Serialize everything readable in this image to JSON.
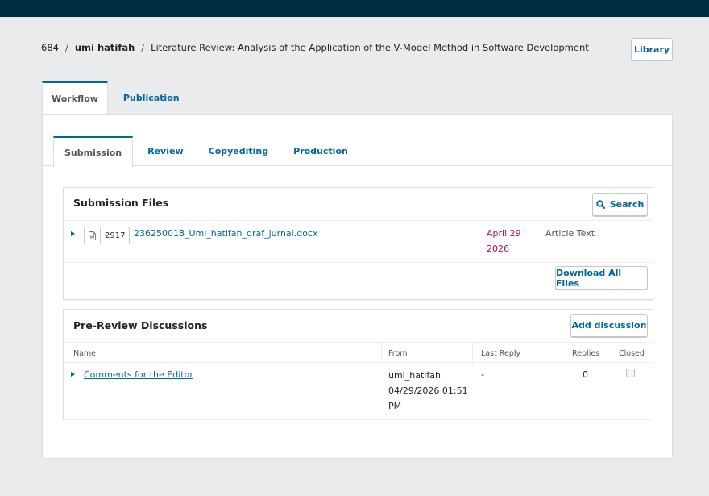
{
  "breadcrumb": {
    "id": "684",
    "separator": "/",
    "author": "umi hatifah",
    "title": "Literature Review: Analysis of the Application of the V-Model Method in Software Development"
  },
  "library_button": "Library",
  "main_tabs": [
    {
      "label": "Workflow",
      "active": true
    },
    {
      "label": "Publication",
      "active": false
    }
  ],
  "stage_tabs": [
    {
      "label": "Submission",
      "active": true
    },
    {
      "label": "Review",
      "active": false
    },
    {
      "label": "Copyediting",
      "active": false
    },
    {
      "label": "Production",
      "active": false
    }
  ],
  "submission_files": {
    "title": "Submission Files",
    "search_label": "Search",
    "files": [
      {
        "id": "2917",
        "name": "236250018_Umi_hatifah_draf_jurnal.docx",
        "date_line1": "April 29",
        "date_line2": "2026",
        "type": "Article Text"
      }
    ],
    "download_all_label": "Download All Files"
  },
  "discussions": {
    "title": "Pre-Review Discussions",
    "add_label": "Add discussion",
    "columns": {
      "name": "Name",
      "from": "From",
      "last_reply": "Last Reply",
      "replies": "Replies",
      "closed": "Closed"
    },
    "rows": [
      {
        "name": "Comments for the Editor",
        "from_user": "umi_hatifah",
        "from_datetime": "04/29/2026 01:51 PM",
        "last_reply": "-",
        "replies": "0",
        "closed": false
      }
    ]
  },
  "colors": {
    "topbar": "#002c40",
    "accent": "#006798",
    "date": "#b10e5b",
    "background": "#e9ebec"
  },
  "icons": {
    "search": "search-icon",
    "file": "word-document-icon",
    "expand": "caret-right-icon"
  }
}
